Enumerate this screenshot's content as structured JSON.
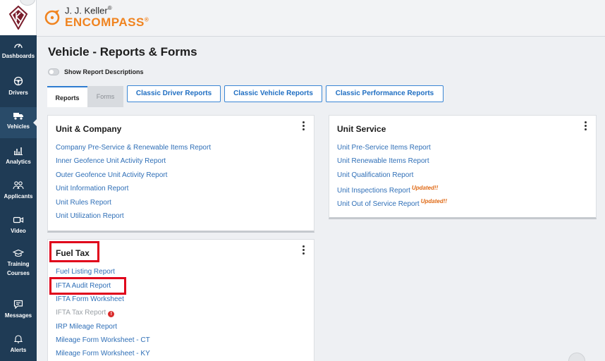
{
  "brand": {
    "top_text": "J. J. Keller",
    "top_reg": "®",
    "main_text": "ENCOMPASS",
    "main_reg": "®",
    "accent": "#f0831f"
  },
  "sidebar": {
    "items": [
      {
        "label": "Dashboards",
        "icon": "gauge-icon"
      },
      {
        "label": "Drivers",
        "icon": "steering-wheel-icon"
      },
      {
        "label": "Vehicles",
        "icon": "truck-icon",
        "active": true
      },
      {
        "label": "Analytics",
        "icon": "bar-chart-icon"
      },
      {
        "label": "Applicants",
        "icon": "people-icon"
      },
      {
        "label": "Video",
        "icon": "video-camera-icon"
      },
      {
        "label": "Training Courses",
        "icon": "graduation-cap-icon"
      },
      {
        "label": "Messages",
        "icon": "message-icon"
      },
      {
        "label": "Alerts",
        "icon": "bell-icon"
      }
    ]
  },
  "page": {
    "title": "Vehicle - Reports & Forms",
    "toggle_label": "Show Report Descriptions"
  },
  "tabs": {
    "reports": "Reports",
    "forms": "Forms"
  },
  "buttons": {
    "classic_driver": "Classic Driver Reports",
    "classic_vehicle": "Classic Vehicle Reports",
    "classic_performance": "Classic Performance Reports"
  },
  "cards": {
    "unit_company": {
      "title": "Unit & Company",
      "links": [
        "Company Pre-Service & Renewable Items Report",
        "Inner Geofence Unit Activity Report",
        "Outer Geofence Unit Activity Report",
        "Unit Information Report",
        "Unit Rules Report",
        "Unit Utilization Report"
      ]
    },
    "unit_service": {
      "title": "Unit Service",
      "links": [
        "Unit Pre-Service Items Report",
        "Unit Renewable Items Report",
        "Unit Qualification Report",
        "Unit Inspections Report",
        "Unit Out of Service Report"
      ],
      "updated_badge": "Updated!!"
    },
    "fuel_tax": {
      "title": "Fuel Tax",
      "links": [
        "Fuel Listing Report",
        "IFTA Audit Report",
        "IFTA Form Worksheet",
        "IFTA Tax Report",
        "IRP Mileage Report",
        "Mileage Form Worksheet - CT",
        "Mileage Form Worksheet - KY"
      ],
      "warning_glyph": "!"
    }
  },
  "colors": {
    "sidebar_bg": "#1f3b55",
    "link": "#2f6fb7",
    "highlight": "#e0001b",
    "updated": "#e06a16"
  }
}
